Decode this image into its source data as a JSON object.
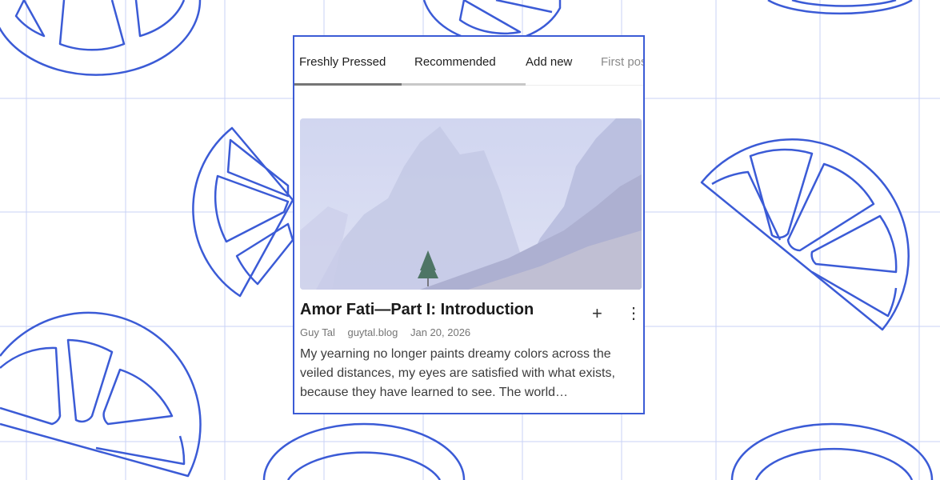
{
  "colors": {
    "accent": "#3b5bd6",
    "grid": "#c9d2f5",
    "tab_active": "#757575",
    "tab_inactive": "#c8c8c8"
  },
  "tabs": [
    {
      "label": "Freshly Pressed",
      "active": true
    },
    {
      "label": "Recommended",
      "active": false
    },
    {
      "label": "Add new",
      "active": false
    },
    {
      "label": "First posts",
      "active": false
    }
  ],
  "post": {
    "title": "Amor Fati—Part I: Introduction",
    "author": "Guy Tal",
    "site": "guytal.blog",
    "date": "Jan 20, 2026",
    "excerpt": "My yearning no longer paints dreamy colors across the veiled distances, my eyes are satisfied with what exists, because they have learned to see. The world…",
    "add_icon": "plus-icon",
    "more_icon": "more-vertical-icon",
    "image": "misty-mountain-with-lone-tree"
  }
}
